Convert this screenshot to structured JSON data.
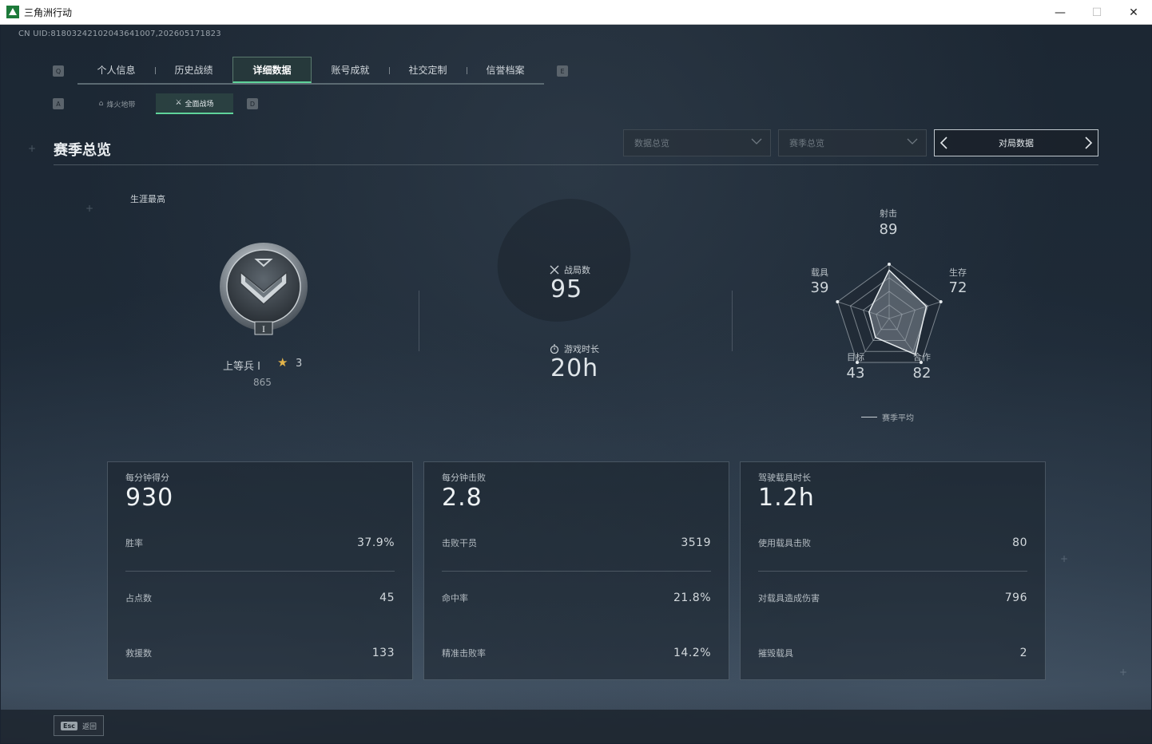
{
  "window": {
    "title": "三角洲行动",
    "minimize": "—",
    "maximize": "☐",
    "close": "✕"
  },
  "uid": "CN UID:8180324210204364100​7,202605171823",
  "main_tabs": [
    {
      "label": "个人信息"
    },
    {
      "label": "历史战绩"
    },
    {
      "label": "详细数据",
      "active": true
    },
    {
      "label": "账号成就"
    },
    {
      "label": "社交定制"
    },
    {
      "label": "信誉档案"
    }
  ],
  "key_hints": {
    "prev_main": "Q",
    "next_main": "E",
    "prev_sub": "A",
    "next_sub": "D"
  },
  "sub_tabs": [
    {
      "label": "烽火地带",
      "icon": "outpost-icon"
    },
    {
      "label": "全面战场",
      "icon": "battlefield-icon",
      "active": true
    }
  ],
  "section": {
    "title": "赛季总览",
    "dropdown1": "数据总览",
    "dropdown2": "赛季总览",
    "pager_label": "对局数据"
  },
  "rank": {
    "label": "生涯最高",
    "name": "上等兵 I",
    "stars": "3",
    "points": "865",
    "badge_numeral": "I"
  },
  "overview": {
    "matches_label": "战局数",
    "matches": "95",
    "playtime_label": "游戏时长",
    "playtime": "20h"
  },
  "radar": {
    "axes": [
      {
        "label": "射击",
        "value": "89",
        "score": 89
      },
      {
        "label": "生存",
        "value": "72",
        "score": 72
      },
      {
        "label": "合作",
        "value": "82",
        "score": 82
      },
      {
        "label": "目标",
        "value": "43",
        "score": 43
      },
      {
        "label": "载具",
        "value": "39",
        "score": 39
      }
    ],
    "legend": "赛季平均"
  },
  "cards": [
    {
      "title": "每分钟得分",
      "value": "930",
      "rows": [
        {
          "k": "胜率",
          "v": "37.9%"
        },
        {
          "k": "占点数",
          "v": "45"
        },
        {
          "k": "救援数",
          "v": "133"
        }
      ]
    },
    {
      "title": "每分钟击败",
      "value": "2.8",
      "rows": [
        {
          "k": "击败干员",
          "v": "3519"
        },
        {
          "k": "命中率",
          "v": "21.8%"
        },
        {
          "k": "精准击败率",
          "v": "14.2%"
        }
      ]
    },
    {
      "title": "驾驶载具时长",
      "value": "1.2h",
      "rows": [
        {
          "k": "使用载具击败",
          "v": "80"
        },
        {
          "k": "对载具造成伤害",
          "v": "796"
        },
        {
          "k": "摧毁载具",
          "v": "2"
        }
      ]
    }
  ],
  "bottom": {
    "esc_key": "Esc",
    "esc_label": "返回"
  },
  "colors": {
    "accent": "#5fd39a",
    "star": "#e3b44a"
  }
}
